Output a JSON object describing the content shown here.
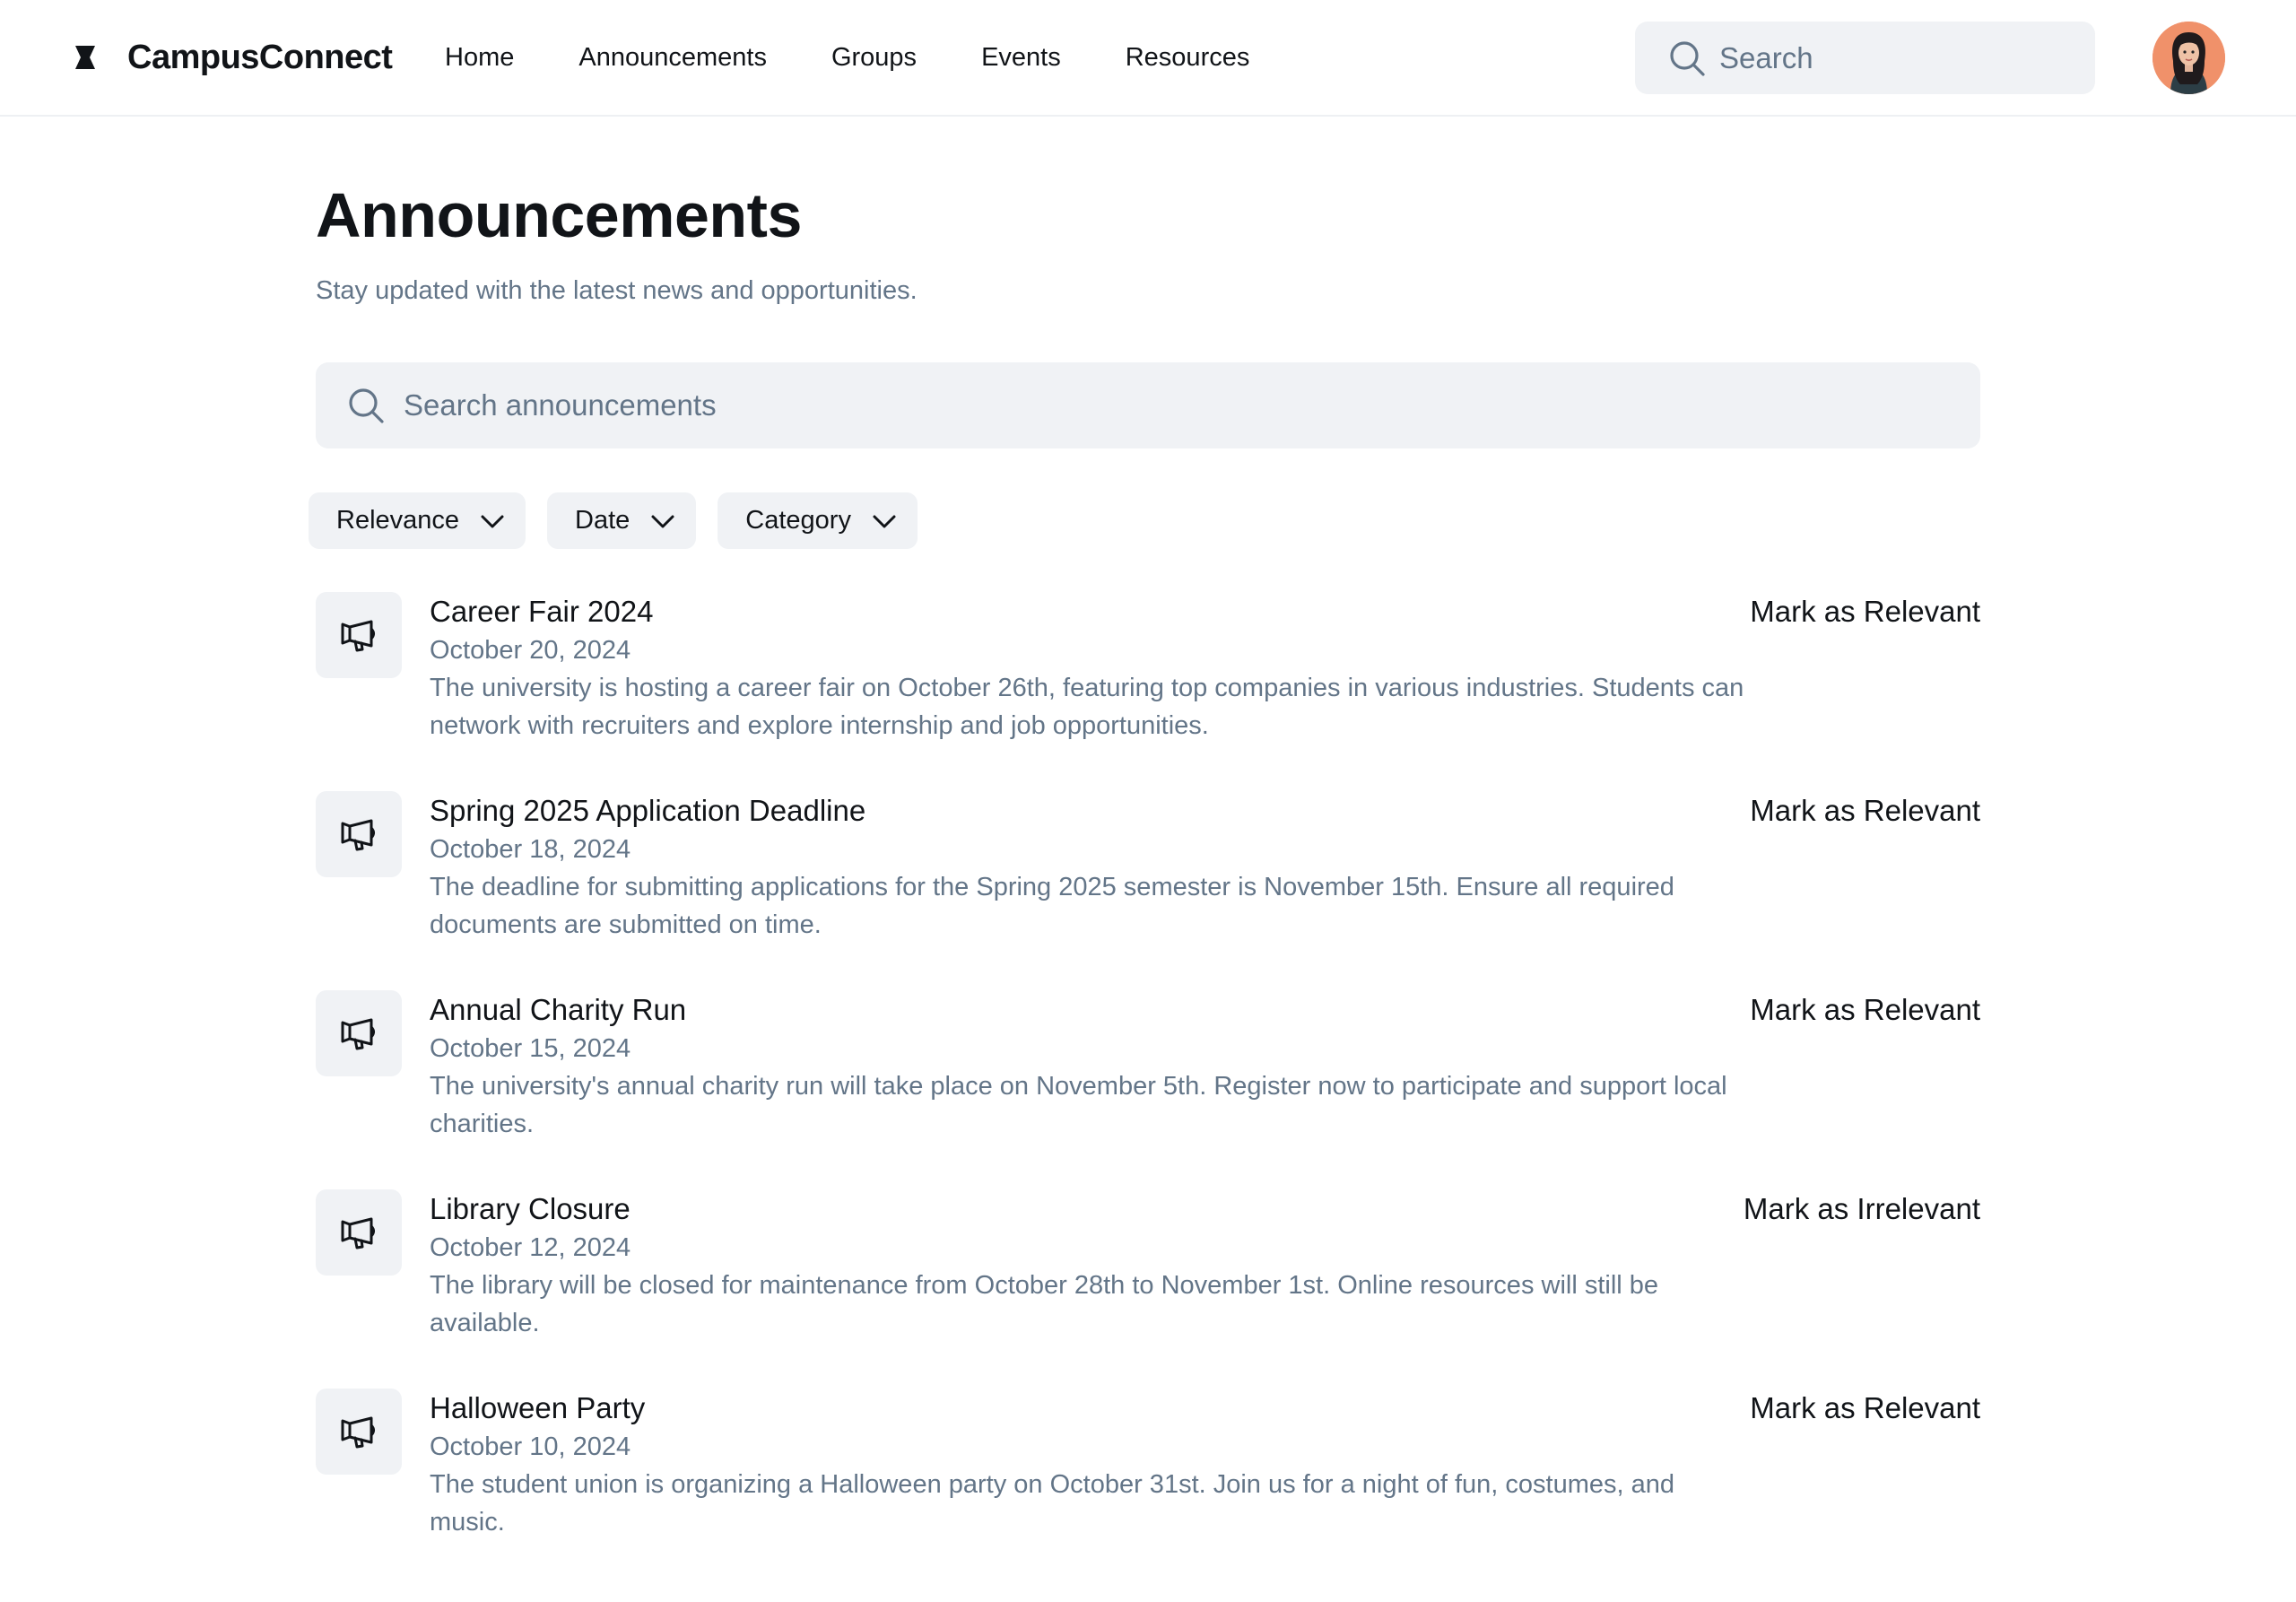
{
  "app": {
    "name": "CampusConnect",
    "logo_icon": "hourglass-logo-icon"
  },
  "nav": {
    "items": [
      {
        "label": "Home"
      },
      {
        "label": "Announcements"
      },
      {
        "label": "Groups"
      },
      {
        "label": "Events"
      },
      {
        "label": "Resources"
      }
    ]
  },
  "top_search": {
    "placeholder": "Search",
    "icon": "search-icon"
  },
  "user": {
    "avatar": "user-avatar"
  },
  "page": {
    "title": "Announcements",
    "subtitle": "Stay updated with the latest news and opportunities."
  },
  "announcement_search": {
    "placeholder": "Search announcements",
    "icon": "search-icon"
  },
  "filters": [
    {
      "label": "Relevance",
      "icon": "chevron-down-icon"
    },
    {
      "label": "Date",
      "icon": "chevron-down-icon"
    },
    {
      "label": "Category",
      "icon": "chevron-down-icon"
    }
  ],
  "announcements": [
    {
      "icon": "megaphone-icon",
      "title": "Career Fair 2024",
      "date": "October 20, 2024",
      "description": "The university is hosting a career fair on October 26th, featuring top companies in various industries. Students can network with recruiters and explore internship and job opportunities.",
      "action": "Mark as Relevant"
    },
    {
      "icon": "megaphone-icon",
      "title": "Spring 2025 Application Deadline",
      "date": "October 18, 2024",
      "description": "The deadline for submitting applications for the Spring 2025 semester is November 15th. Ensure all required documents are submitted on time.",
      "action": "Mark as Relevant"
    },
    {
      "icon": "megaphone-icon",
      "title": "Annual Charity Run",
      "date": "October 15, 2024",
      "description": "The university's annual charity run will take place on November 5th. Register now to participate and support local charities.",
      "action": "Mark as Relevant"
    },
    {
      "icon": "megaphone-icon",
      "title": "Library Closure",
      "date": "October 12, 2024",
      "description": "The library will be closed for maintenance from October 28th to November 1st. Online resources will still be available.",
      "action": "Mark as Irrelevant"
    },
    {
      "icon": "megaphone-icon",
      "title": "Halloween Party",
      "date": "October 10, 2024",
      "description": "The student union is organizing a Halloween party on October 31st. Join us for a night of fun, costumes, and music.",
      "action": "Mark as Relevant"
    }
  ],
  "colors": {
    "text_primary": "#111418",
    "text_secondary": "#637588",
    "surface": "#f0f2f5",
    "border": "#eef0f3",
    "avatar_bg": "#f0916a"
  }
}
